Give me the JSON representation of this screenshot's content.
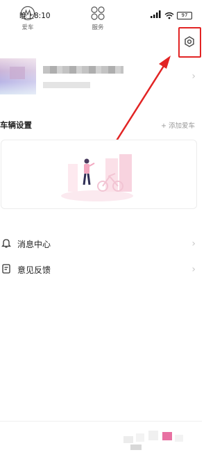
{
  "status_bar": {
    "time": "晚上8:10",
    "signal": "4G",
    "battery": "97"
  },
  "settings_button": {
    "icon": "settings-icon",
    "highlight_color": "#e22424"
  },
  "vehicle_section": {
    "title": "车辆设置",
    "add_button": "+ 添加爱车"
  },
  "menu": [
    {
      "label": "消息中心",
      "icon": "bell-icon"
    },
    {
      "label": "意见反馈",
      "icon": "feedback-icon"
    }
  ],
  "bottom_nav": [
    {
      "label": "爱车",
      "icon": "car-logo-icon"
    },
    {
      "label": "服务",
      "icon": "service-grid-icon"
    }
  ],
  "colors": {
    "accent": "#e22424",
    "illustration": "#f4c6d6",
    "text": "#222222"
  }
}
